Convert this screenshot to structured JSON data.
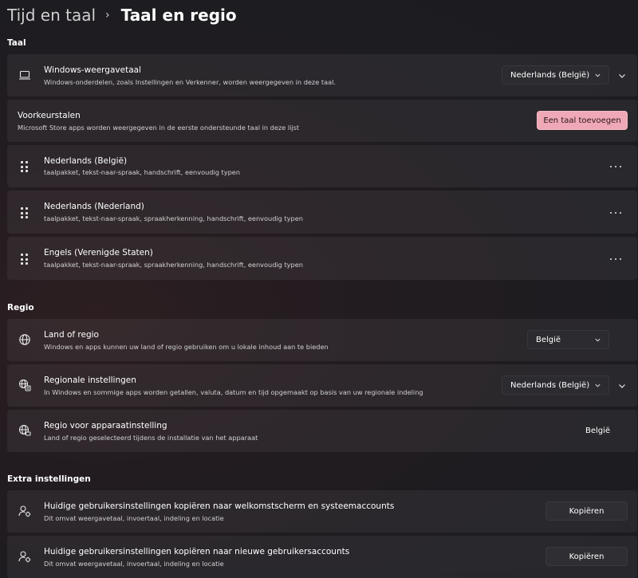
{
  "breadcrumb": {
    "parent": "Tijd en taal",
    "separator": "›",
    "current": "Taal en regio"
  },
  "sections": {
    "taal": "Taal",
    "regio": "Regio",
    "extra": "Extra instellingen"
  },
  "display_language": {
    "title": "Windows-weergavetaal",
    "description": "Windows-onderdelen, zoals Instellingen en Verkenner, worden weergegeven in deze taal.",
    "value": "Nederlands (België)"
  },
  "preferred": {
    "title": "Voorkeurstalen",
    "description": "Microsoft Store apps worden weergegeven in de eerste ondersteunde taal in deze lijst",
    "add_button": "Een taal toevoegen"
  },
  "languages": [
    {
      "name": "Nederlands (België)",
      "features": "taalpakket, tekst-naar-spraak, handschrift, eenvoudig typen"
    },
    {
      "name": "Nederlands (Nederland)",
      "features": "taalpakket, tekst-naar-spraak, spraakherkenning, handschrift, eenvoudig typen"
    },
    {
      "name": "Engels (Verenigde Staten)",
      "features": "taalpakket, tekst-naar-spraak, spraakherkenning, handschrift, eenvoudig typen"
    }
  ],
  "country": {
    "title": "Land of regio",
    "description": "Windows en apps kunnen uw land of regio gebruiken om u lokale inhoud aan te bieden",
    "value": "België"
  },
  "regional_format": {
    "title": "Regionale instellingen",
    "description": "In Windows en sommige apps worden getallen, valuta, datum en tijd opgemaakt op basis van uw regionale indeling",
    "value": "Nederlands (België)"
  },
  "device_region": {
    "title": "Regio voor apparaatinstelling",
    "description": "Land of regio geselecteerd tijdens de installatie van het apparaat",
    "value": "België"
  },
  "copy_welcome": {
    "title": "Huidige gebruikersinstellingen kopiëren naar welkomstscherm en systeemaccounts",
    "description": "Dit omvat weergavetaal, invoertaal, indeling en locatie",
    "button": "Kopiëren"
  },
  "copy_new_users": {
    "title": "Huidige gebruikersinstellingen kopiëren naar nieuwe gebruikersaccounts",
    "description": "Dit omvat weergavetaal, invoertaal, indeling en locatie",
    "button": "Kopiëren"
  },
  "colors": {
    "accent": "#efa8b6",
    "card": "#2a282d",
    "background": "#1e1c21"
  }
}
